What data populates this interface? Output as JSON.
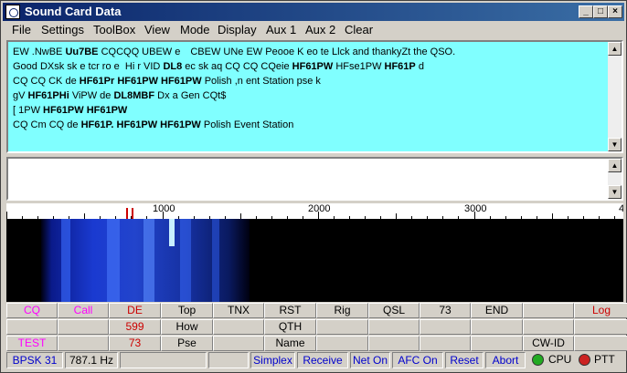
{
  "window": {
    "title": "Sound Card Data",
    "min_glyph": "_",
    "max_glyph": "□",
    "close_glyph": "×"
  },
  "menu": [
    "File",
    "Settings",
    "ToolBox",
    "View",
    "Mode",
    "Display",
    "Aux 1",
    "Aux 2",
    "Clear"
  ],
  "rx_lines": [
    [
      {
        "t": "EW .NwBE  "
      },
      {
        "t": "Uu7BE",
        "b": true
      },
      {
        "t": "  CQCQQ UBEW e　CBEW UNe EW Peooe K  eo te Llck and thankyZt the QSO."
      }
    ],
    [
      {
        "t": "Good DXsk sk e tcr ro e  Hi  r   VID "
      },
      {
        "t": "DL8",
        "b": true
      },
      {
        "t": " ec sk  aq  CQ CQ CQeie "
      },
      {
        "t": "HF61PW",
        "b": true
      },
      {
        "t": " HFse1PW "
      },
      {
        "t": "HF61P",
        "b": true
      },
      {
        "t": " d"
      }
    ],
    [
      {
        "t": "CQ CQ CK de "
      },
      {
        "t": "HF61Pr",
        "b": true
      },
      {
        "t": "  "
      },
      {
        "t": "HF61PW HF61PW",
        "b": true
      },
      {
        "t": " Polish ,n ent Station pse k"
      }
    ],
    [
      {
        "t": "gV "
      },
      {
        "t": "HF61PHi",
        "b": true
      },
      {
        "t": "   ViPW  de "
      },
      {
        "t": "DL8MBF",
        "b": true
      },
      {
        "t": " Dx a Gen CQt$"
      }
    ],
    [
      {
        "t": "[ 1PW "
      },
      {
        "t": "HF61PW HF61PW",
        "b": true
      }
    ],
    [
      {
        "t": "CQ Cm  CQ de "
      },
      {
        "t": "HF61P. HF61PW HF61PW",
        "b": true
      },
      {
        "t": " Polish Event Station"
      }
    ]
  ],
  "scroll": {
    "up": "▲",
    "down": "▼"
  },
  "ruler": {
    "labels": [
      "1000",
      "2000",
      "3000",
      "4"
    ]
  },
  "grid": {
    "row1": [
      "CQ",
      "Call",
      "DE",
      "Top",
      "TNX",
      "RST",
      "Rig",
      "QSL",
      "73",
      "END",
      "",
      "Log"
    ],
    "row2": [
      "",
      "",
      "599",
      "How",
      "",
      "QTH",
      "",
      "",
      "",
      "",
      "",
      ""
    ],
    "row3": [
      "TEST",
      "",
      "73",
      "Pse",
      "",
      "Name",
      "",
      "",
      "",
      "",
      "CW-ID",
      ""
    ]
  },
  "status": {
    "mode": "BPSK 31",
    "freq": "787.1 Hz",
    "simplex": "Simplex",
    "receive": "Receive",
    "net_on": "Net On",
    "afc_on": "AFC On",
    "reset": "Reset",
    "abort": "Abort",
    "cpu": "CPU",
    "ptt": "PTT"
  },
  "colors": {
    "rx_bg": "#80FFFF",
    "magenta": "#FF00FF",
    "red": "#CC0000",
    "status_text": "#0000CC",
    "cpu_led": "#22AA22",
    "ptt_led": "#CC2222"
  }
}
